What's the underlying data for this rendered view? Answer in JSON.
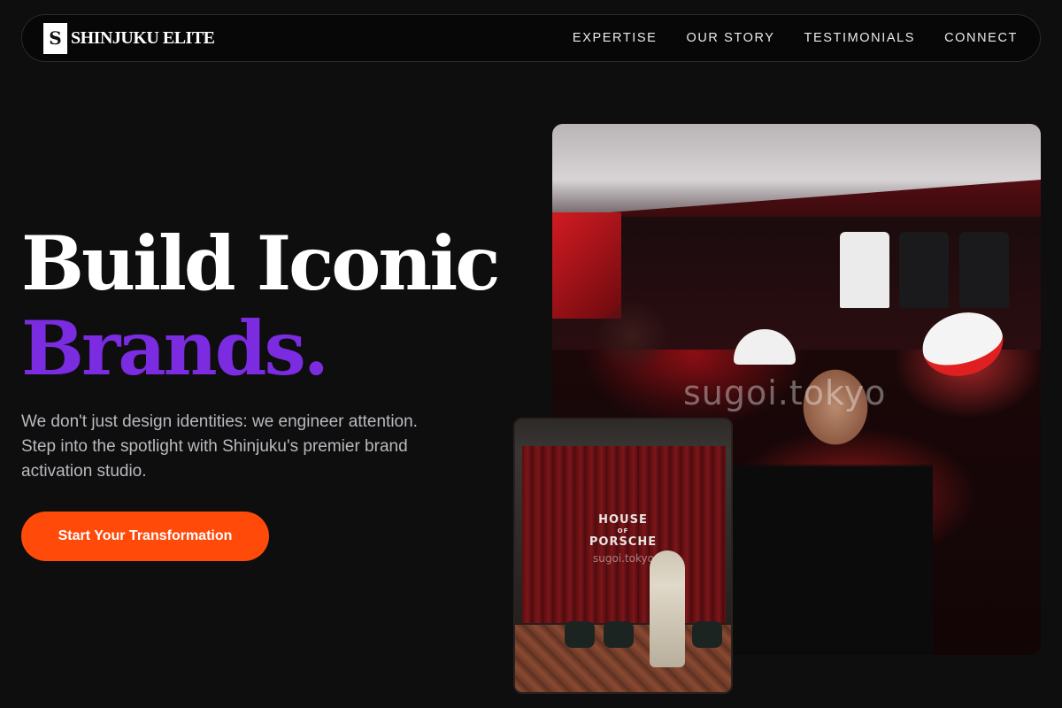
{
  "brand": {
    "mark": "S",
    "name": "SHINJUKU ELITE"
  },
  "nav": {
    "links": [
      "EXPERTISE",
      "OUR STORY",
      "TESTIMONIALS",
      "CONNECT"
    ]
  },
  "hero": {
    "title_line1": "Build Iconic",
    "title_line2": "Brands.",
    "description": "We don't just design identities: we engineer attention. Step into the spotlight with Shinjuku's premier brand activation studio.",
    "cta_label": "Start Your Transformation"
  },
  "photos": {
    "main_watermark": "sugoi.tokyo",
    "inset_sign_line1": "HOUSE",
    "inset_sign_of": "OF",
    "inset_sign_line2": "PORSCHE",
    "inset_watermark": "sugoi.tokyo"
  },
  "colors": {
    "background": "#0e0e0f",
    "accent_purple": "#7b2be0",
    "cta_orange": "#ff4a0a"
  }
}
